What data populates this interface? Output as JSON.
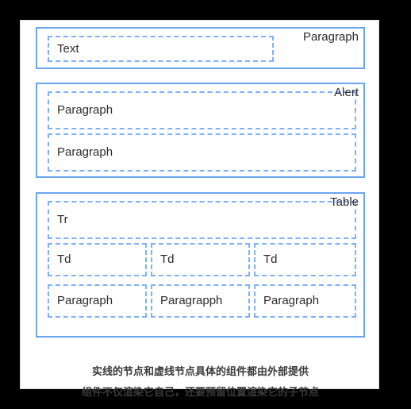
{
  "diagram": {
    "colors": {
      "solid_border": "#6aa5f0",
      "dashed_border": "#7eb1f5",
      "card_background": "#ffffff",
      "page_background": "#000000",
      "text": "#2b2b2b"
    },
    "sections": [
      {
        "name": "paragraph-section",
        "label": "Paragraph",
        "slots": [
          {
            "label": "Text"
          }
        ]
      },
      {
        "name": "alert-section",
        "label": "Alert",
        "slots": [
          {
            "label": "Paragraph"
          },
          {
            "label": "Paragraph"
          }
        ]
      },
      {
        "name": "table-section",
        "label": "Table",
        "slots": [
          {
            "label": "Tr"
          },
          {
            "label": "Td"
          },
          {
            "label": "Td"
          },
          {
            "label": "Td"
          },
          {
            "label": "Paragraph"
          },
          {
            "label": "Paragrapph"
          },
          {
            "label": "Paragraph"
          }
        ]
      }
    ],
    "caption": {
      "line1": "实线的节点和虚线节点具体的组件都由外部提供",
      "line2": "组件不仅渲染它自己，还要预留位置渲染它的子节点"
    }
  }
}
